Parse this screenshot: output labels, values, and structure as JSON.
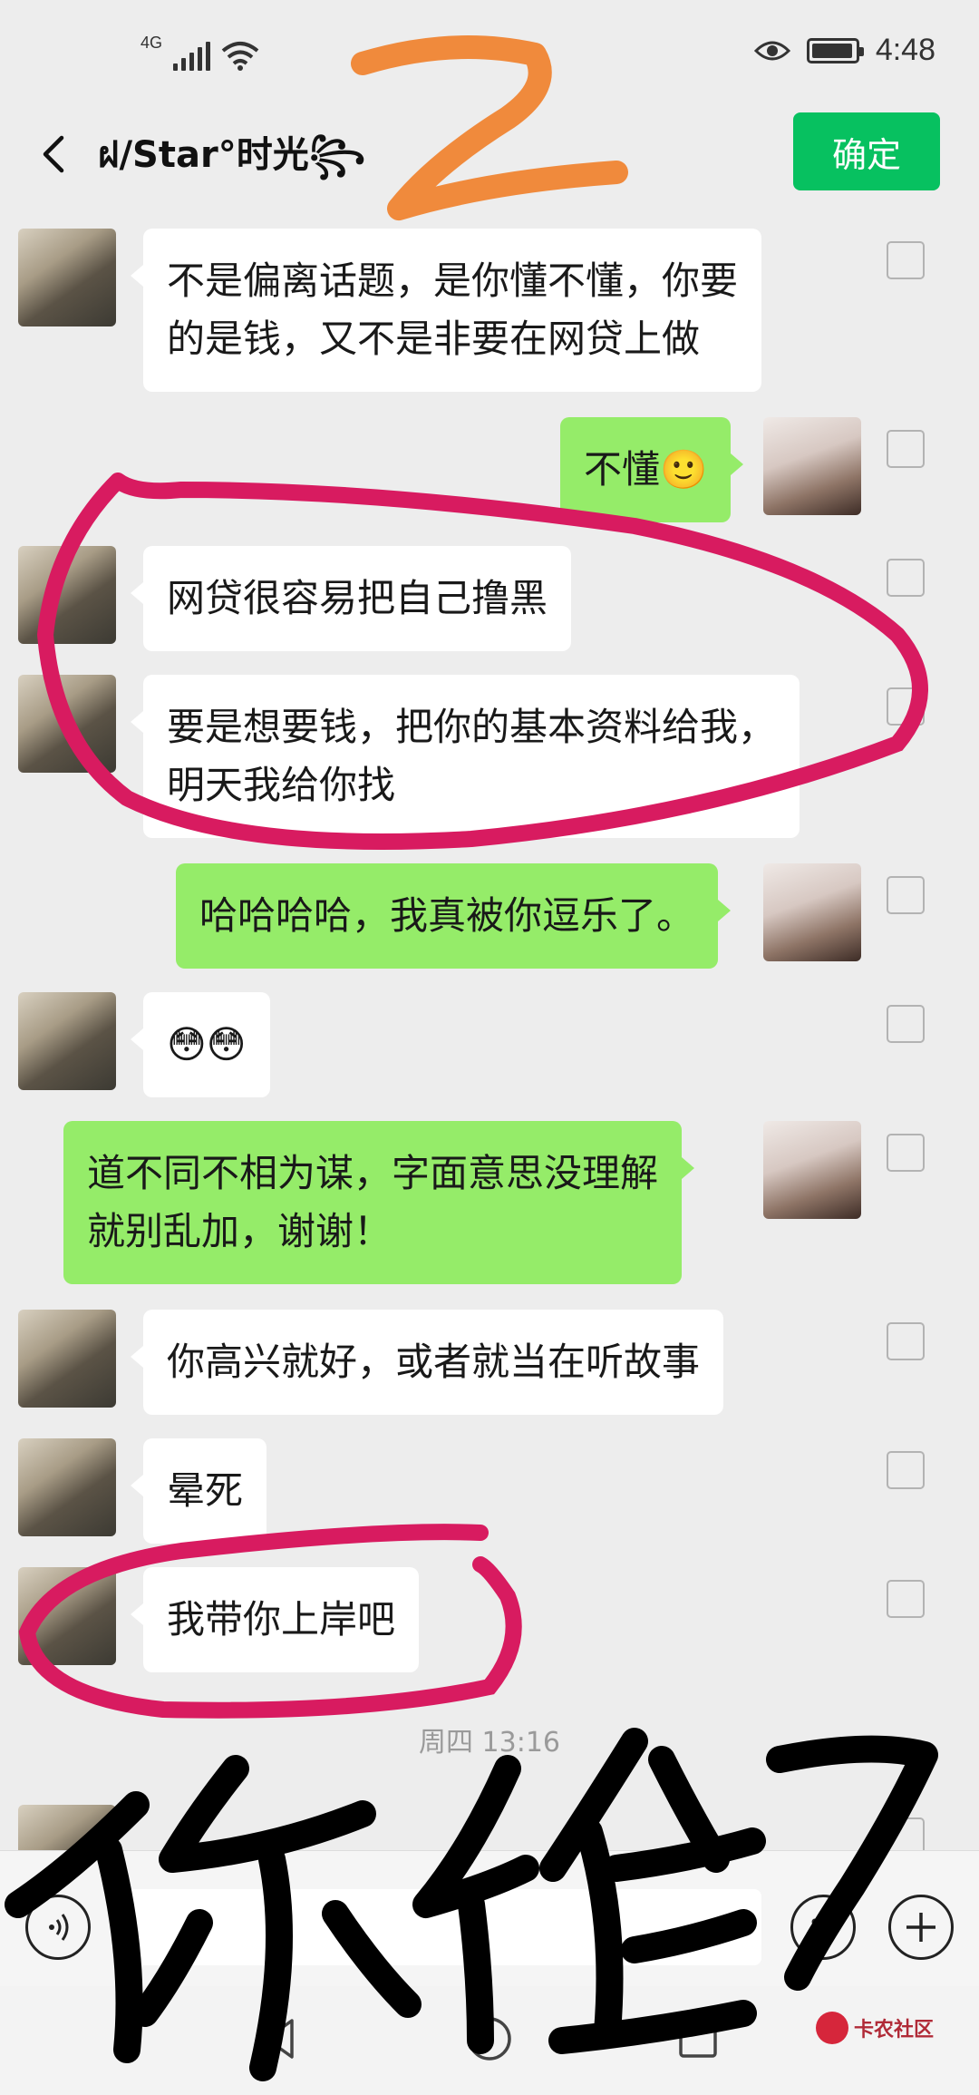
{
  "status_bar": {
    "network": "4G",
    "time": "4:48"
  },
  "header": {
    "title": "ฝ/Star°时光꧂",
    "confirm_label": "确定"
  },
  "messages": [
    {
      "side": "left",
      "text": "不是偏离话题，是你懂不懂，你要\n的是钱，又不是非要在网贷上做"
    },
    {
      "side": "right",
      "text": "不懂🙂"
    },
    {
      "side": "left",
      "text": "网贷很容易把自己撸黑"
    },
    {
      "side": "left",
      "text": "要是想要钱，把你的基本资料给我，\n明天我给你找"
    },
    {
      "side": "right",
      "text": "哈哈哈哈，我真被你逗乐了。"
    },
    {
      "side": "left",
      "text": "😳😳"
    },
    {
      "side": "right",
      "text": "道不同不相为谋，字面意思没理解\n就别乱加，谢谢！"
    },
    {
      "side": "left",
      "text": "你高兴就好，或者就当在听故事"
    },
    {
      "side": "left",
      "text": "晕死"
    },
    {
      "side": "left",
      "text": "我带你上岸吧"
    }
  ],
  "timestamp": "周四 13:16",
  "watermark": "卡农社区",
  "colors": {
    "accent": "#07c160",
    "sent_bubble": "#95ec69",
    "received_bubble": "#ffffff",
    "background": "#ededed",
    "annotation_pink": "#d81b60",
    "annotation_orange": "#f08a3c"
  }
}
